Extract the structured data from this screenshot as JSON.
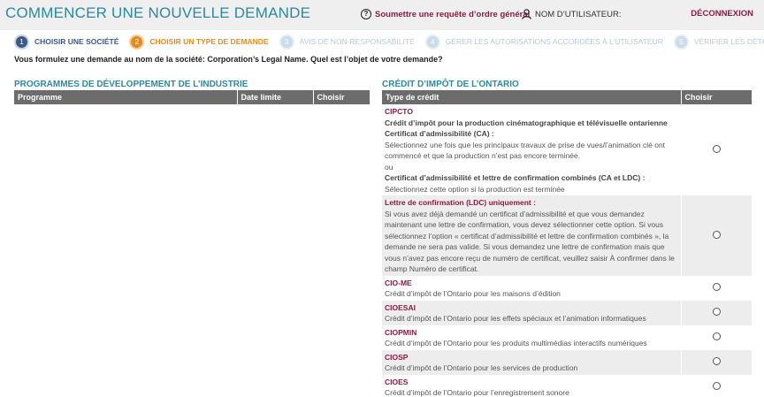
{
  "header": {
    "title": "COMMENCER UNE NOUVELLE DEMANDE",
    "help_link": "Soumettre une requête d’ordre général",
    "username_label": "NOM D’UTILISATEUR:",
    "logout": "DÉCONNEXION"
  },
  "steps": [
    {
      "num": "1",
      "label": "CHOISIR UNE SOCIÉTÉ",
      "state": "done"
    },
    {
      "num": "2",
      "label": "CHOISIR UN TYPE DE DEMANDE",
      "state": "active"
    },
    {
      "num": "3",
      "label": "AVIS DE NON-RESPONSABILITÉ",
      "state": "todo"
    },
    {
      "num": "4",
      "label": "GÉRER LES AUTORISATIONS ACCORDÉES À L’UTILISATEUR",
      "state": "todo"
    },
    {
      "num": "5",
      "label": "VÉRIFIER LES DÉTAILS",
      "state": "todo"
    }
  ],
  "question": "Vous formulez une demande au nom de la société: Corporation’s Legal Name. Quel est l’objet de votre demande?",
  "left_section": {
    "title": "PROGRAMMES DE DÉVELOPPEMENT DE L’INDUSTRIE",
    "columns": [
      "Programme",
      "Date limite",
      "Choisir"
    ]
  },
  "right_section": {
    "title": "CRÉDIT D’IMPÔT DE L’ONTARIO",
    "columns": [
      "Type de crédit",
      "Choisir"
    ],
    "cipcto": {
      "code": "CIPCTO",
      "name": "Crédit d’impôt pour la production cinématographique et télévisuelle ontarienne",
      "ca_title": "Certificat d’admissibilité (CA) :",
      "ca_text": "Sélectionnez une fois que les principaux travaux de prise de vues/l’animation clé ont commencé et que la production n’est pas encore terminée.",
      "or": "ou",
      "ca_ldc_title": "Certificat d’admissibilité et lettre de confirmation combinés (CA et LDC) :",
      "ca_ldc_text": "Sélectionnez cette option si la production est terminée"
    },
    "ldc": {
      "title": "Lettre de confirmation (LDC) uniquement :",
      "text": "Si vous avez déjà demandé un certificat d’admissibilité et que vous demandez maintenant une lettre de confirmation, vous devez sélectionner cette option. Si vous sélectionnez l’option « certificat d’admissibilité et lettre de confirmation combinés », la demande ne sera pas valide. Si vous demandez une lettre de confirmation mais que vous n’avez pas encore reçu de numéro de certificat, veuillez saisir À confirmer dans le champ Numéro de certificat."
    },
    "others": [
      {
        "code": "CIO-ME",
        "desc": "Crédit d’impôt de l’Ontario pour les maisons d’édition"
      },
      {
        "code": "CIOESAI",
        "desc": "Crédit d’impôt de l’Ontario pour les effets spéciaux et l’animation informatiques"
      },
      {
        "code": "CIOPMIN",
        "desc": "Crédit d’impôt de l’Ontario pour les produits multimédias interactifs numériques"
      },
      {
        "code": "CIOSP",
        "desc": "Crédit d’impôt de l’Ontario pour les services de production"
      },
      {
        "code": "CIOES",
        "desc": "Crédit d’impôt de l’Ontario pour l’enregistrement sonore"
      }
    ]
  }
}
